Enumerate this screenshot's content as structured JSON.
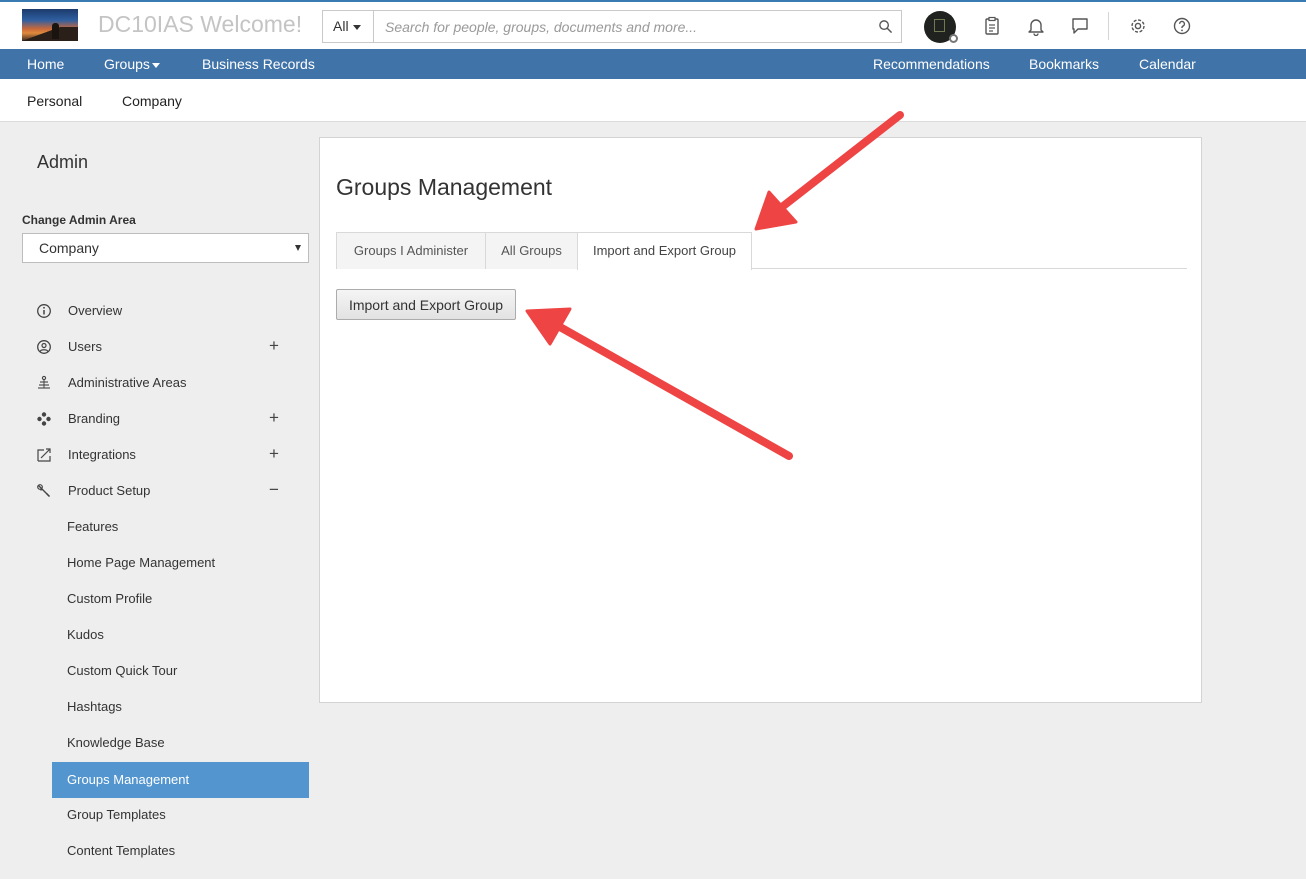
{
  "header": {
    "site_title": "DC10IAS Welcome!",
    "search_scope": "All",
    "search_placeholder": "Search for people, groups, documents and more..."
  },
  "nav": {
    "left": [
      "Home",
      "Groups",
      "Business Records"
    ],
    "right": [
      "Recommendations",
      "Bookmarks",
      "Calendar"
    ]
  },
  "subnav": [
    "Personal",
    "Company"
  ],
  "sidebar": {
    "title": "Admin",
    "change_area_label": "Change Admin Area",
    "area_selected": "Company",
    "items": [
      {
        "label": "Overview",
        "icon": "info-icon",
        "toggle": ""
      },
      {
        "label": "Users",
        "icon": "user-circle-icon",
        "toggle": "+"
      },
      {
        "label": "Administrative Areas",
        "icon": "hierarchy-icon",
        "toggle": ""
      },
      {
        "label": "Branding",
        "icon": "palette-icon",
        "toggle": "+"
      },
      {
        "label": "Integrations",
        "icon": "integration-icon",
        "toggle": "+"
      },
      {
        "label": "Product Setup",
        "icon": "wrench-icon",
        "toggle": "−"
      }
    ],
    "sub_items": [
      "Features",
      "Home Page Management",
      "Custom Profile",
      "Kudos",
      "Custom Quick Tour",
      "Hashtags",
      "Knowledge Base",
      "Groups Management",
      "Group Templates",
      "Content Templates"
    ],
    "active_sub_item": "Groups Management"
  },
  "main": {
    "title": "Groups Management",
    "tabs": [
      "Groups I Administer",
      "All Groups",
      "Import and Export Group"
    ],
    "active_tab": "Import and Export Group",
    "action_button": "Import and Export Group"
  },
  "colors": {
    "accent_blue": "#4073a8",
    "active_item_blue": "#5395cf",
    "annotation_arrow": "#ee4444"
  }
}
